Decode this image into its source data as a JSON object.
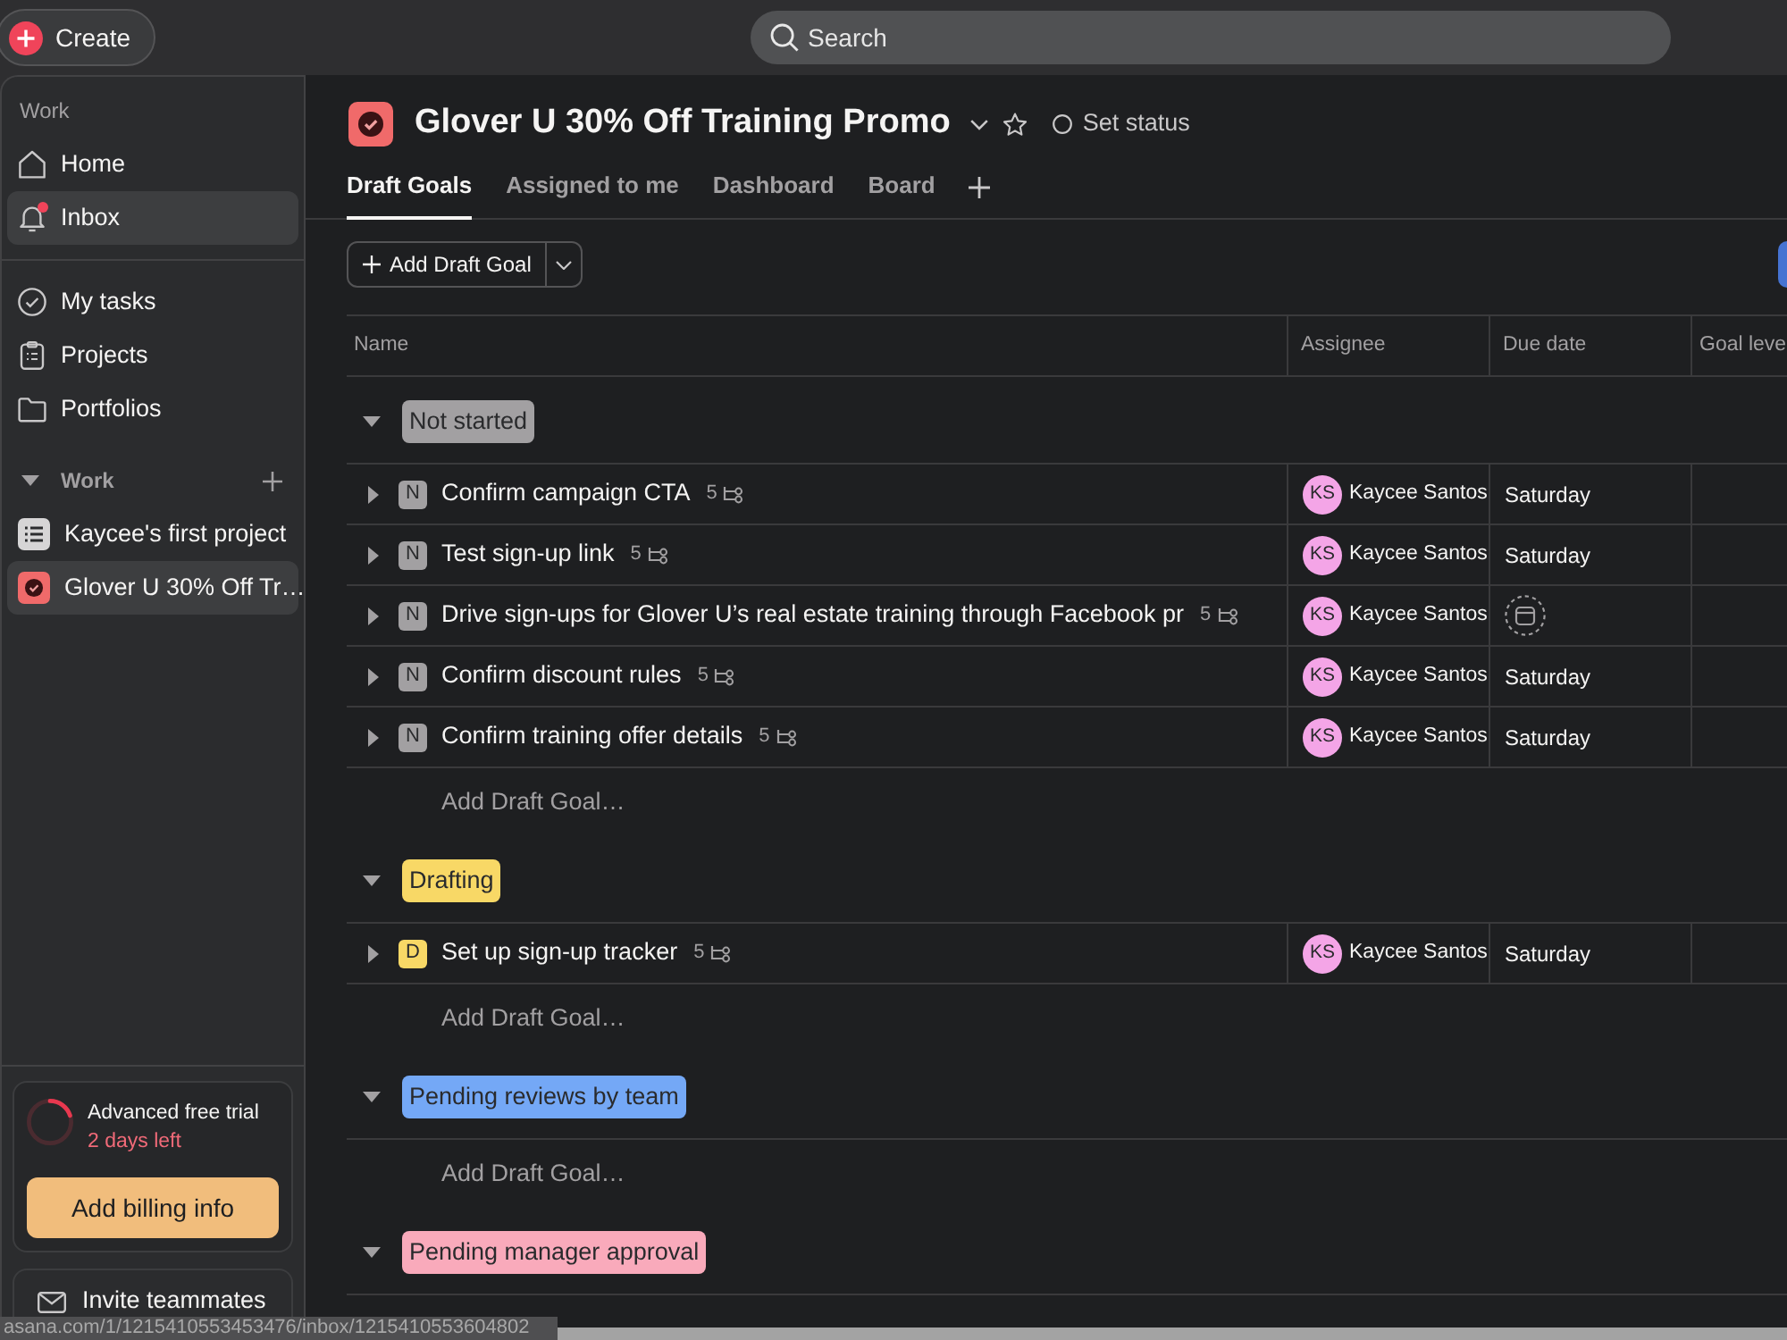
{
  "topbar": {
    "create_button": "Create",
    "search": {
      "placeholder": "Search"
    }
  },
  "sidebar": {
    "section_label": "Work",
    "nav_groups": [
      {
        "items": [
          {
            "kind": "home",
            "label": "Home",
            "selected": false,
            "unread": false
          },
          {
            "kind": "inbox",
            "label": "Inbox",
            "selected": true,
            "unread": true
          }
        ]
      },
      {
        "items": [
          {
            "kind": "tasks",
            "label": "My tasks",
            "selected": false,
            "unread": false
          },
          {
            "kind": "projects",
            "label": "Projects",
            "selected": false,
            "unread": false
          },
          {
            "kind": "portfolios",
            "label": "Portfolios",
            "selected": false,
            "unread": false
          }
        ]
      }
    ],
    "team": {
      "title": "Work",
      "expanded": true,
      "projects": [
        {
          "kind": "list",
          "name": "Kaycee's first project",
          "selected": false
        },
        {
          "kind": "goal",
          "name": "Glover U 30% Off Tr…",
          "selected": true
        }
      ]
    },
    "trial": {
      "title": "Advanced free trial",
      "remaining": "2 days left",
      "button": "Add billing info"
    },
    "invite": {
      "label": "Invite teammates"
    }
  },
  "project": {
    "title": "Glover U 30% Off Training Promo",
    "status_button": "Set status",
    "tabs": [
      {
        "label": "Draft Goals",
        "selected": true
      },
      {
        "label": "Assigned to me",
        "selected": false
      },
      {
        "label": "Dashboard",
        "selected": false
      },
      {
        "label": "Board",
        "selected": false
      }
    ],
    "toolbar": {
      "add_button": "Add Draft Goal"
    },
    "table": {
      "columns": [
        "Name",
        "Assignee",
        "Due date",
        "Goal leve"
      ],
      "groups": [
        {
          "name": "Not started",
          "color": "#a2a0a2",
          "expanded": true,
          "tasks": [
            {
              "badge": "N",
              "name": "Confirm campaign CTA",
              "subtasks": "5",
              "expanded": false,
              "assignee": {
                "initials": "KS",
                "name": "Kaycee Santos"
              },
              "due": "Saturday"
            },
            {
              "badge": "N",
              "name": "Test sign-up link",
              "subtasks": "5",
              "expanded": false,
              "assignee": {
                "initials": "KS",
                "name": "Kaycee Santos"
              },
              "due": "Saturday"
            },
            {
              "badge": "N",
              "name": "Drive sign-ups for Glover U’s real estate training through Facebook pr",
              "subtasks": "5",
              "expanded": false,
              "assignee": {
                "initials": "KS",
                "name": "Kaycee Santos"
              }
            },
            {
              "badge": "N",
              "name": "Confirm discount rules",
              "subtasks": "5",
              "expanded": false,
              "assignee": {
                "initials": "KS",
                "name": "Kaycee Santos"
              },
              "due": "Saturday"
            },
            {
              "badge": "N",
              "name": "Confirm training offer details",
              "subtasks": "5",
              "expanded": false,
              "assignee": {
                "initials": "KS",
                "name": "Kaycee Santos"
              },
              "due": "Saturday"
            }
          ],
          "add_row": "Add Draft Goal…"
        },
        {
          "name": "Drafting",
          "color": "#f8d866",
          "expanded": true,
          "tasks": [
            {
              "badge": "D",
              "name": "Set up sign-up tracker",
              "subtasks": "5",
              "expanded": false,
              "assignee": {
                "initials": "KS",
                "name": "Kaycee Santos"
              },
              "due": "Saturday"
            }
          ],
          "add_row": "Add Draft Goal…"
        },
        {
          "name": "Pending reviews by team",
          "color": "#74a8f6",
          "expanded": true,
          "add_row": "Add Draft Goal…"
        },
        {
          "name": "Pending manager approval",
          "color": "#f9aabb",
          "expanded": true
        }
      ]
    }
  },
  "status_bar": {
    "url": "asana.com/1/1215410553453476/inbox/1215410553604802"
  }
}
